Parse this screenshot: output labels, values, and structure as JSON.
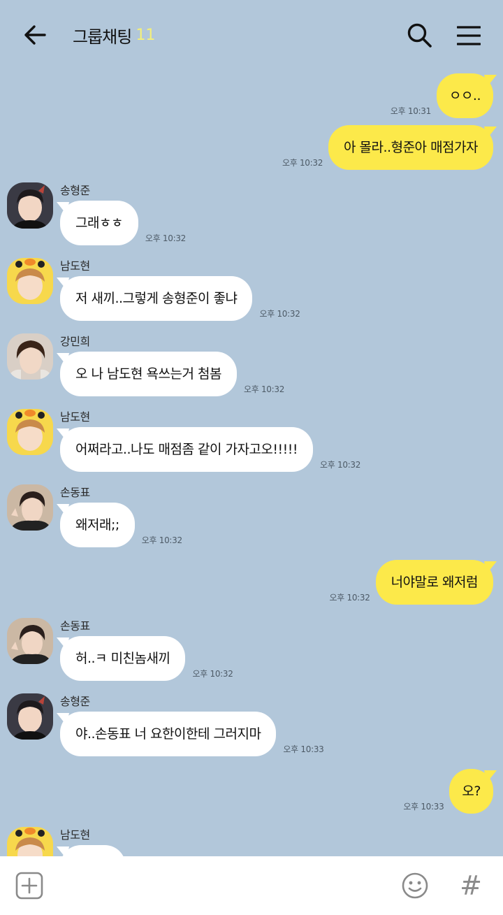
{
  "header": {
    "title": "그룹채팅",
    "member_count": "11"
  },
  "messages": [
    {
      "type": "out",
      "text": "ㅇㅇ..",
      "time": "오후 10:31"
    },
    {
      "type": "out",
      "text": "아 몰라..형준아 매점가자",
      "time": "오후 10:32"
    },
    {
      "type": "in",
      "sender": "송형준",
      "text": "그래ㅎㅎ",
      "time": "오후 10:32"
    },
    {
      "type": "in",
      "sender": "남도현",
      "text": "저 새끼..그렇게 송형준이 좋냐",
      "time": "오후 10:32"
    },
    {
      "type": "in",
      "sender": "강민희",
      "text": "오 나 남도현 욕쓰는거 첨봄",
      "time": "오후 10:32"
    },
    {
      "type": "in",
      "sender": "남도현",
      "text": "어쩌라고..나도 매점좀 같이 가자고오!!!!!",
      "time": "오후 10:32"
    },
    {
      "type": "in",
      "sender": "손동표",
      "text": "왜저래;;",
      "time": "오후 10:32"
    },
    {
      "type": "out",
      "text": "너야말로 왜저럼",
      "time": "오후 10:32"
    },
    {
      "type": "in",
      "sender": "손동표",
      "text": "허..ㅋ 미친놈새끼",
      "time": "오후 10:32"
    },
    {
      "type": "in",
      "sender": "송형준",
      "text": "야..손동표 너 요한이한테 그러지마",
      "time": "오후 10:33"
    },
    {
      "type": "out",
      "text": "오?",
      "time": "오후 10:33"
    },
    {
      "type": "in",
      "sender": "남도현",
      "text": "",
      "time": ""
    }
  ],
  "icons": {
    "back": "arrow-left-icon",
    "search": "search-icon",
    "menu": "hamburger-menu-icon",
    "attach": "plus-square-icon",
    "emoji": "smiley-icon",
    "hashtag": "hashtag-icon"
  },
  "colors": {
    "background": "#b2c7da",
    "outgoing_bubble": "#fce94a",
    "incoming_bubble": "#ffffff",
    "member_count": "#f4f07a"
  },
  "bottombar": {
    "hashtag_symbol": "#"
  }
}
